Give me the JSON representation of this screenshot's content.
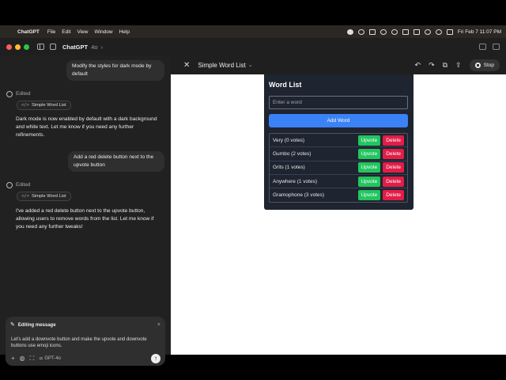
{
  "menubar": {
    "app": "ChatGPT",
    "menus": [
      "File",
      "Edit",
      "View",
      "Window",
      "Help"
    ],
    "clock": "Fri Feb 7  11:07 PM"
  },
  "titlebar": {
    "model": "ChatGPT",
    "version": "4o",
    "chevron": "›"
  },
  "chat": {
    "msg1": "Modify the styles for dark mode by default",
    "edited1": "Edited",
    "chip1": "Simple Word List",
    "reply1": "Dark mode is now enabled by default with a dark background and white text. Let me know if you need any further refinements.",
    "msg2": "Add a red delete button next to the upvote button",
    "edited2": "Edited",
    "chip2": "Simple Word List",
    "reply2": "I've added a red delete button next to the upvote button, allowing users to remove words from the list. Let me know if you need any further tweaks!",
    "code_icon": "</>"
  },
  "editing": {
    "label": "Editing message",
    "text": "Let's add a downvote button and make the upvote and downvote buttons use emoji icons.",
    "model": "GPT-4o",
    "close": "×",
    "send": "↑",
    "plus": "+"
  },
  "canvas": {
    "close": "✕",
    "title": "Simple Word List",
    "chevron": "⌄",
    "stop": "Stop"
  },
  "wordlist": {
    "title": "Word List",
    "placeholder": "Enter a word",
    "add": "Add Word",
    "upvote": "Upvote",
    "delete": "Delete",
    "items": [
      {
        "label": "Very (0 votes)"
      },
      {
        "label": "Gumbo (2 votes)"
      },
      {
        "label": "Grits (1 votes)"
      },
      {
        "label": "Anywhere (1 votes)"
      },
      {
        "label": "Gramophone (3 votes)"
      }
    ]
  },
  "colors": {
    "accent": "#3b82f6",
    "upvote": "#22c55e",
    "delete": "#e11d48"
  }
}
